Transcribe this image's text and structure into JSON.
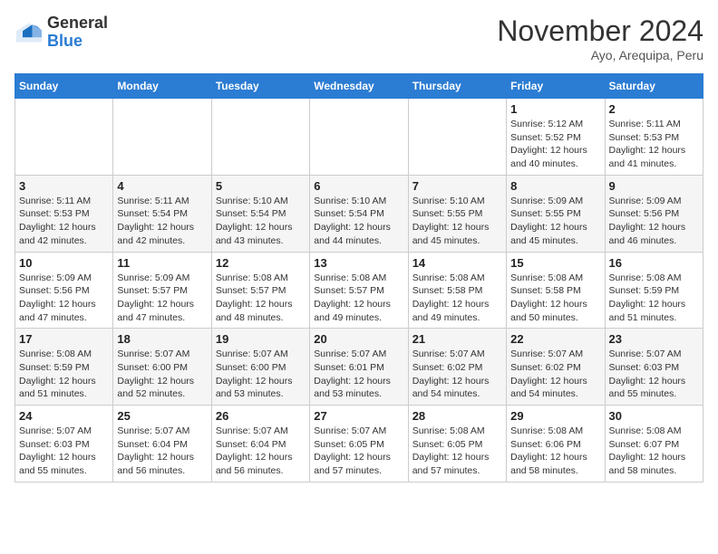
{
  "header": {
    "logo_line1": "General",
    "logo_line2": "Blue",
    "month": "November 2024",
    "location": "Ayo, Arequipa, Peru"
  },
  "days_of_week": [
    "Sunday",
    "Monday",
    "Tuesday",
    "Wednesday",
    "Thursday",
    "Friday",
    "Saturday"
  ],
  "weeks": [
    [
      {
        "day": "",
        "info": ""
      },
      {
        "day": "",
        "info": ""
      },
      {
        "day": "",
        "info": ""
      },
      {
        "day": "",
        "info": ""
      },
      {
        "day": "",
        "info": ""
      },
      {
        "day": "1",
        "info": "Sunrise: 5:12 AM\nSunset: 5:52 PM\nDaylight: 12 hours\nand 40 minutes."
      },
      {
        "day": "2",
        "info": "Sunrise: 5:11 AM\nSunset: 5:53 PM\nDaylight: 12 hours\nand 41 minutes."
      }
    ],
    [
      {
        "day": "3",
        "info": "Sunrise: 5:11 AM\nSunset: 5:53 PM\nDaylight: 12 hours\nand 42 minutes."
      },
      {
        "day": "4",
        "info": "Sunrise: 5:11 AM\nSunset: 5:54 PM\nDaylight: 12 hours\nand 42 minutes."
      },
      {
        "day": "5",
        "info": "Sunrise: 5:10 AM\nSunset: 5:54 PM\nDaylight: 12 hours\nand 43 minutes."
      },
      {
        "day": "6",
        "info": "Sunrise: 5:10 AM\nSunset: 5:54 PM\nDaylight: 12 hours\nand 44 minutes."
      },
      {
        "day": "7",
        "info": "Sunrise: 5:10 AM\nSunset: 5:55 PM\nDaylight: 12 hours\nand 45 minutes."
      },
      {
        "day": "8",
        "info": "Sunrise: 5:09 AM\nSunset: 5:55 PM\nDaylight: 12 hours\nand 45 minutes."
      },
      {
        "day": "9",
        "info": "Sunrise: 5:09 AM\nSunset: 5:56 PM\nDaylight: 12 hours\nand 46 minutes."
      }
    ],
    [
      {
        "day": "10",
        "info": "Sunrise: 5:09 AM\nSunset: 5:56 PM\nDaylight: 12 hours\nand 47 minutes."
      },
      {
        "day": "11",
        "info": "Sunrise: 5:09 AM\nSunset: 5:57 PM\nDaylight: 12 hours\nand 47 minutes."
      },
      {
        "day": "12",
        "info": "Sunrise: 5:08 AM\nSunset: 5:57 PM\nDaylight: 12 hours\nand 48 minutes."
      },
      {
        "day": "13",
        "info": "Sunrise: 5:08 AM\nSunset: 5:57 PM\nDaylight: 12 hours\nand 49 minutes."
      },
      {
        "day": "14",
        "info": "Sunrise: 5:08 AM\nSunset: 5:58 PM\nDaylight: 12 hours\nand 49 minutes."
      },
      {
        "day": "15",
        "info": "Sunrise: 5:08 AM\nSunset: 5:58 PM\nDaylight: 12 hours\nand 50 minutes."
      },
      {
        "day": "16",
        "info": "Sunrise: 5:08 AM\nSunset: 5:59 PM\nDaylight: 12 hours\nand 51 minutes."
      }
    ],
    [
      {
        "day": "17",
        "info": "Sunrise: 5:08 AM\nSunset: 5:59 PM\nDaylight: 12 hours\nand 51 minutes."
      },
      {
        "day": "18",
        "info": "Sunrise: 5:07 AM\nSunset: 6:00 PM\nDaylight: 12 hours\nand 52 minutes."
      },
      {
        "day": "19",
        "info": "Sunrise: 5:07 AM\nSunset: 6:00 PM\nDaylight: 12 hours\nand 53 minutes."
      },
      {
        "day": "20",
        "info": "Sunrise: 5:07 AM\nSunset: 6:01 PM\nDaylight: 12 hours\nand 53 minutes."
      },
      {
        "day": "21",
        "info": "Sunrise: 5:07 AM\nSunset: 6:02 PM\nDaylight: 12 hours\nand 54 minutes."
      },
      {
        "day": "22",
        "info": "Sunrise: 5:07 AM\nSunset: 6:02 PM\nDaylight: 12 hours\nand 54 minutes."
      },
      {
        "day": "23",
        "info": "Sunrise: 5:07 AM\nSunset: 6:03 PM\nDaylight: 12 hours\nand 55 minutes."
      }
    ],
    [
      {
        "day": "24",
        "info": "Sunrise: 5:07 AM\nSunset: 6:03 PM\nDaylight: 12 hours\nand 55 minutes."
      },
      {
        "day": "25",
        "info": "Sunrise: 5:07 AM\nSunset: 6:04 PM\nDaylight: 12 hours\nand 56 minutes."
      },
      {
        "day": "26",
        "info": "Sunrise: 5:07 AM\nSunset: 6:04 PM\nDaylight: 12 hours\nand 56 minutes."
      },
      {
        "day": "27",
        "info": "Sunrise: 5:07 AM\nSunset: 6:05 PM\nDaylight: 12 hours\nand 57 minutes."
      },
      {
        "day": "28",
        "info": "Sunrise: 5:08 AM\nSunset: 6:05 PM\nDaylight: 12 hours\nand 57 minutes."
      },
      {
        "day": "29",
        "info": "Sunrise: 5:08 AM\nSunset: 6:06 PM\nDaylight: 12 hours\nand 58 minutes."
      },
      {
        "day": "30",
        "info": "Sunrise: 5:08 AM\nSunset: 6:07 PM\nDaylight: 12 hours\nand 58 minutes."
      }
    ]
  ]
}
